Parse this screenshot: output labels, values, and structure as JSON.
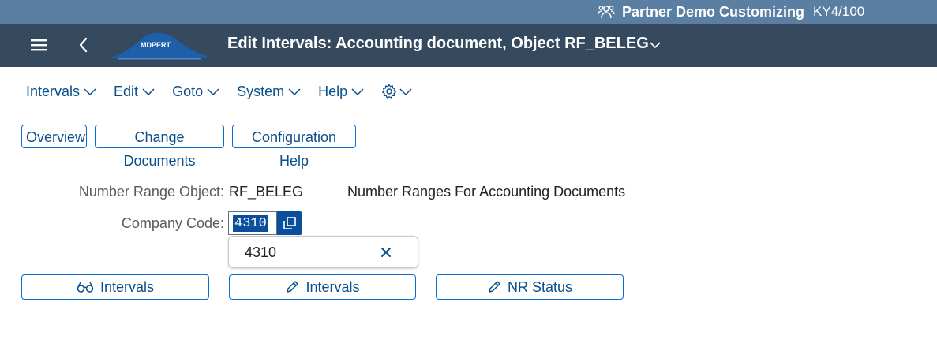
{
  "header": {
    "partner_name": "Partner Demo Customizing",
    "system_id": "KY4/100",
    "title": "Edit Intervals: Accounting document, Object RF_BELEG",
    "logo_text": "MDPERT"
  },
  "menu": {
    "items": [
      {
        "label": "Intervals"
      },
      {
        "label": "Edit"
      },
      {
        "label": "Goto"
      },
      {
        "label": "System"
      },
      {
        "label": "Help"
      }
    ]
  },
  "toolbar": {
    "overview": "Overview",
    "change_documents": "Change Documents",
    "configuration_help": "Configuration Help"
  },
  "form": {
    "nr_object_label": "Number Range Object:",
    "nr_object_value": "RF_BELEG",
    "nr_object_desc": "Number Ranges For Accounting Documents",
    "company_code_label": "Company Code:",
    "company_code_value": "4310"
  },
  "popover": {
    "value": "4310"
  },
  "actions": {
    "display_intervals": "Intervals",
    "change_intervals": "Intervals",
    "nr_status": "NR Status"
  },
  "colors": {
    "topbar": "#5b7ea3",
    "shellbar": "#354a5f",
    "link": "#0a4f8b",
    "button_border": "#0a6ed1",
    "selection": "#0a4f9c"
  }
}
